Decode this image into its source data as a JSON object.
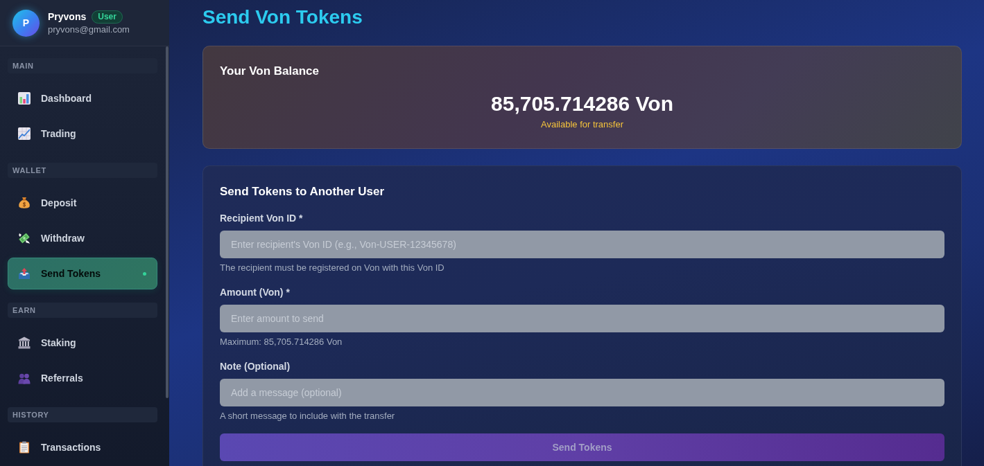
{
  "sidebar": {
    "user": {
      "avatar_initial": "P",
      "name": "Pryvons",
      "role_badge": "User",
      "email": "pryvons@gmail.com"
    },
    "sections": [
      {
        "title": "MAIN",
        "items": [
          {
            "label": "Dashboard",
            "selected": false
          },
          {
            "label": "Trading",
            "selected": false
          }
        ]
      },
      {
        "title": "WALLET",
        "items": [
          {
            "label": "Deposit",
            "selected": false
          },
          {
            "label": "Withdraw",
            "selected": false
          },
          {
            "label": "Send Tokens",
            "selected": true
          }
        ]
      },
      {
        "title": "EARN",
        "items": [
          {
            "label": "Staking",
            "selected": false
          },
          {
            "label": "Referrals",
            "selected": false
          }
        ]
      },
      {
        "title": "HISTORY",
        "items": [
          {
            "label": "Transactions",
            "selected": false
          }
        ]
      }
    ]
  },
  "page": {
    "title": "Send Von Tokens"
  },
  "balance_card": {
    "title": "Your Von Balance",
    "amount": "85,705.714286 Von",
    "caption": "Available for transfer"
  },
  "transfer_form": {
    "title": "Send Tokens to Another User",
    "fields": [
      {
        "label": "Recipient Von ID *",
        "placeholder": "Enter recipient's Von ID (e.g., Von-USER-12345678)",
        "help": "The recipient must be registered on Von with this Von ID"
      },
      {
        "label": "Amount (Von) *",
        "placeholder": "Enter amount to send",
        "help": "Maximum: 85,705.714286 Von"
      },
      {
        "label": "Note (Optional)",
        "placeholder": "Add a message (optional)",
        "help": "A short message to include with the transfer"
      }
    ],
    "submit": {
      "label": "Send Tokens",
      "disabled": true
    }
  }
}
